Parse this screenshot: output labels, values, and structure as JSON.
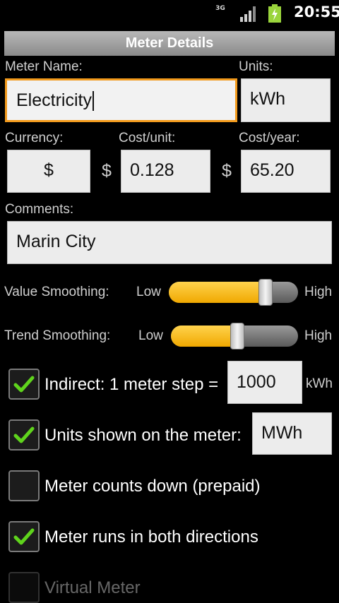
{
  "status_bar": {
    "network": "3G",
    "time": "20:55"
  },
  "title": "Meter Details",
  "meter_name": {
    "label": "Meter Name:",
    "value": "Electricity"
  },
  "units": {
    "label": "Units:",
    "value": "kWh"
  },
  "currency": {
    "label": "Currency:",
    "value": "$"
  },
  "cost_unit": {
    "label": "Cost/unit:",
    "prefix": "$",
    "value": "0.128"
  },
  "cost_year": {
    "label": "Cost/year:",
    "prefix": "$",
    "value": "65.20"
  },
  "comments": {
    "label": "Comments:",
    "value": "Marin City"
  },
  "value_smoothing": {
    "label": "Value Smoothing:",
    "low": "Low",
    "high": "High",
    "level": 0.75
  },
  "trend_smoothing": {
    "label": "Trend Smoothing:",
    "low": "Low",
    "high": "High",
    "level": 0.52
  },
  "indirect": {
    "label": "Indirect: 1 meter step =",
    "checked": true,
    "value": "1000",
    "unit": "kWh"
  },
  "units_shown": {
    "label": "Units shown on the meter:",
    "checked": true,
    "value": "MWh"
  },
  "counts_down": {
    "label": "Meter counts down (prepaid)",
    "checked": false
  },
  "both_directions": {
    "label": "Meter runs in both directions",
    "checked": true
  },
  "virtual_meter": {
    "label": "Virtual Meter",
    "checked": false,
    "enabled": false
  },
  "colors": {
    "accent": "#f0a800",
    "focus": "#f29a1c",
    "check": "#5fd41c"
  }
}
